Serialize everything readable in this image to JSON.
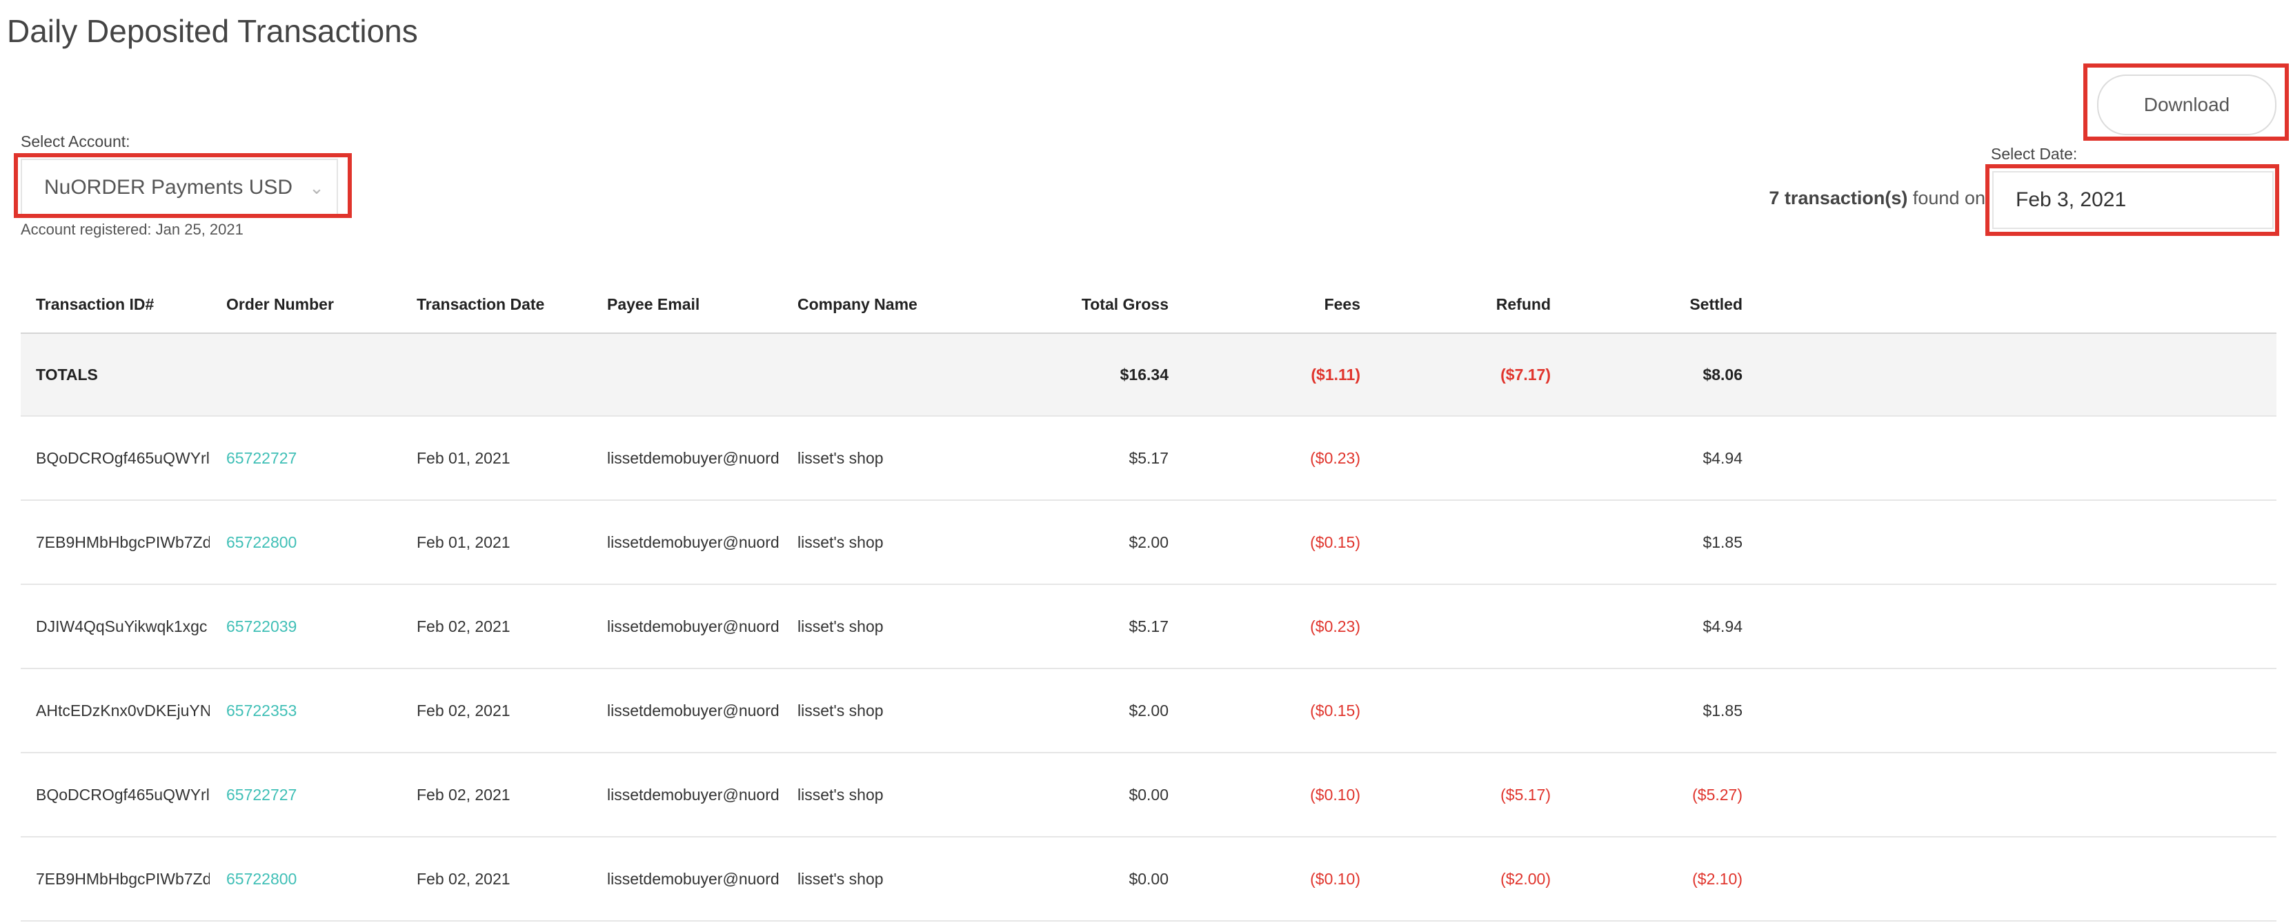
{
  "page": {
    "title": "Daily Deposited Transactions"
  },
  "download": {
    "label": "Download"
  },
  "account": {
    "label": "Select Account:",
    "selected": "NuORDER Payments USD",
    "registered": "Account registered: Jan 25, 2021"
  },
  "date": {
    "label": "Select Date:",
    "value": "Feb 3, 2021",
    "count": "7 transaction(s)",
    "found_text": "found on"
  },
  "colors": {
    "link": "#3fbfb6",
    "negative": "#e0342c",
    "highlight": "#e0342c"
  },
  "icons": {
    "account_dropdown": "chevron-down-icon"
  },
  "table": {
    "headers": {
      "id": "Transaction ID#",
      "order": "Order Number",
      "date": "Transaction Date",
      "email": "Payee Email",
      "company": "Company Name",
      "gross": "Total Gross",
      "fees": "Fees",
      "refund": "Refund",
      "settled": "Settled"
    },
    "totals": {
      "label": "TOTALS",
      "gross": "$16.34",
      "fees": "($1.11)",
      "refund": "($7.17)",
      "settled": "$8.06"
    },
    "rows": [
      {
        "id": "BQoDCROgf465uQWYrl",
        "order": "65722727",
        "date": "Feb 01, 2021",
        "email": "lissetdemobuyer@nuorder.com",
        "company": "lisset's shop",
        "gross": "$5.17",
        "fees": "($0.23)",
        "refund": "",
        "settled": "$4.94"
      },
      {
        "id": "7EB9HMbHbgcPIWb7Zd",
        "order": "65722800",
        "date": "Feb 01, 2021",
        "email": "lissetdemobuyer@nuorder.com",
        "company": "lisset's shop",
        "gross": "$2.00",
        "fees": "($0.15)",
        "refund": "",
        "settled": "$1.85"
      },
      {
        "id": "DJIW4QqSuYikwqk1xgc",
        "order": "65722039",
        "date": "Feb 02, 2021",
        "email": "lissetdemobuyer@nuorder.com",
        "company": "lisset's shop",
        "gross": "$5.17",
        "fees": "($0.23)",
        "refund": "",
        "settled": "$4.94"
      },
      {
        "id": "AHtcEDzKnx0vDKEjuYN",
        "order": "65722353",
        "date": "Feb 02, 2021",
        "email": "lissetdemobuyer@nuorder.com",
        "company": "lisset's shop",
        "gross": "$2.00",
        "fees": "($0.15)",
        "refund": "",
        "settled": "$1.85"
      },
      {
        "id": "BQoDCROgf465uQWYrl",
        "order": "65722727",
        "date": "Feb 02, 2021",
        "email": "lissetdemobuyer@nuorder.com",
        "company": "lisset's shop",
        "gross": "$0.00",
        "fees": "($0.10)",
        "refund": "($5.17)",
        "settled": "($5.27)"
      },
      {
        "id": "7EB9HMbHbgcPIWb7Zd",
        "order": "65722800",
        "date": "Feb 02, 2021",
        "email": "lissetdemobuyer@nuorder.com",
        "company": "lisset's shop",
        "gross": "$0.00",
        "fees": "($0.10)",
        "refund": "($2.00)",
        "settled": "($2.10)"
      }
    ]
  }
}
